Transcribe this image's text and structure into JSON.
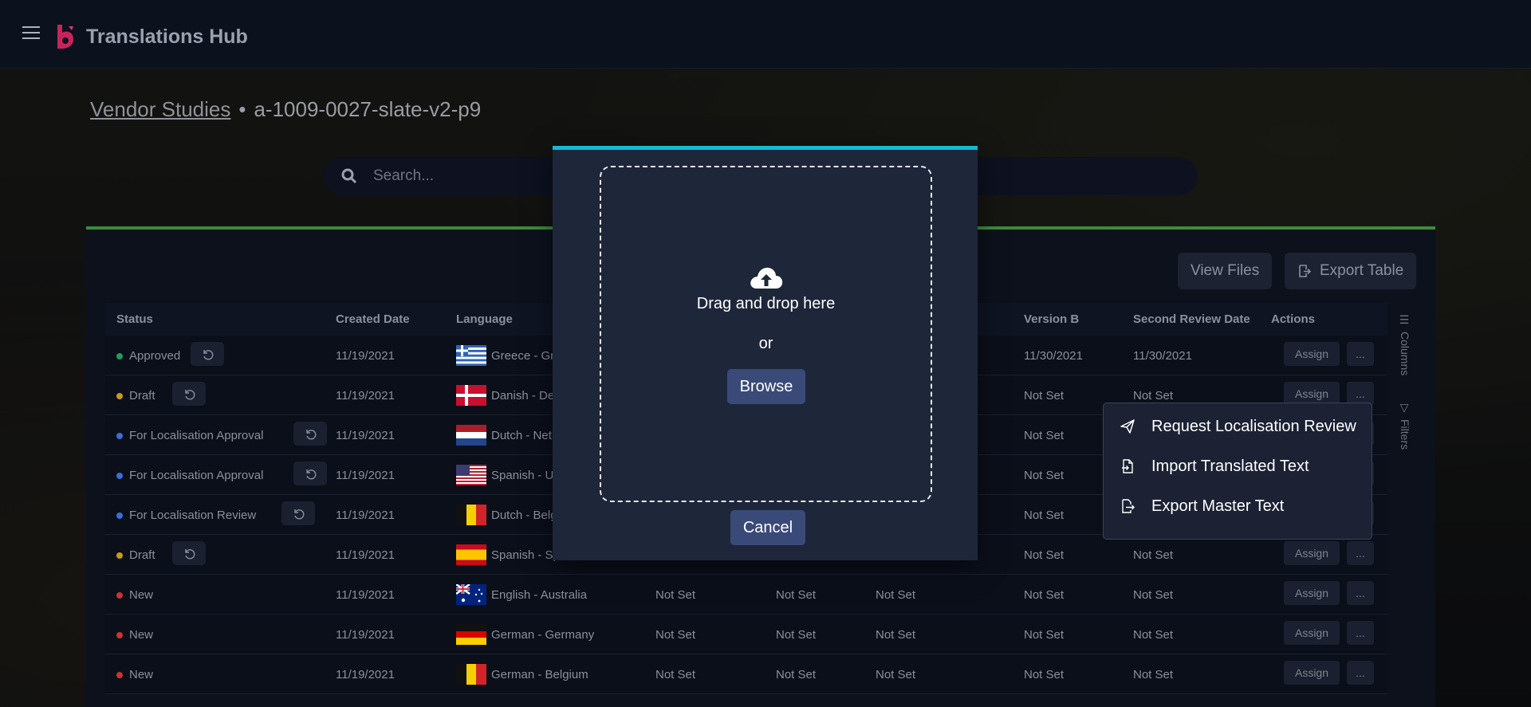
{
  "app": {
    "title": "Translations Hub",
    "logo_name": "translations-hub-logo-icon"
  },
  "breadcrumb": {
    "parent": "Vendor Studies",
    "separator": "•",
    "current": "a-1009-0027-slate-v2-p9"
  },
  "search": {
    "placeholder": "Search..."
  },
  "toolbar": {
    "view_files": "View Files",
    "export_table": "Export Table"
  },
  "columns": [
    "Status",
    "Created Date",
    "Language",
    "Version B",
    "Second Review Date",
    "Actions"
  ],
  "sidetabs": {
    "columns": "Columns",
    "filters": "Filters"
  },
  "status_colors": {
    "Approved": "#1e9e5a",
    "Draft": "#c99a1a",
    "For Localisation Approval": "#3b6fd6",
    "For Localisation Review": "#3b6fd6",
    "New": "#c73535"
  },
  "rows": [
    {
      "status": "Approved",
      "created": "11/19/2021",
      "language": "Greece - Gre",
      "flag": "greece",
      "c4": "",
      "c5": "",
      "c6": "",
      "version_b": "11/30/2021",
      "second_review": "11/30/2021",
      "undo": true
    },
    {
      "status": "Draft",
      "created": "11/19/2021",
      "language": "Danish - Den",
      "flag": "denmark",
      "c4": "",
      "c5": "",
      "c6": "",
      "version_b": "Not Set",
      "second_review": "Not Set",
      "undo": true
    },
    {
      "status": "For Localisation Approval",
      "created": "11/19/2021",
      "language": "Dutch - Neth",
      "flag": "netherlands",
      "c4": "",
      "c5": "",
      "c6": "",
      "version_b": "Not Set",
      "second_review": "",
      "undo": true
    },
    {
      "status": "For Localisation Approval",
      "created": "11/19/2021",
      "language": "Spanish - US",
      "flag": "usa",
      "c4": "",
      "c5": "",
      "c6": "",
      "version_b": "Not Set",
      "second_review": "",
      "undo": true
    },
    {
      "status": "For Localisation Review",
      "created": "11/19/2021",
      "language": "Dutch - Belg",
      "flag": "belgium",
      "c4": "",
      "c5": "",
      "c6": "",
      "version_b": "Not Set",
      "second_review": "",
      "undo": true
    },
    {
      "status": "Draft",
      "created": "11/19/2021",
      "language": "Spanish - Sp",
      "flag": "spain",
      "c4": "",
      "c5": "",
      "c6": "",
      "version_b": "Not Set",
      "second_review": "Not Set",
      "undo": true
    },
    {
      "status": "New",
      "created": "11/19/2021",
      "language": "English - Australia",
      "flag": "australia",
      "c4": "Not Set",
      "c5": "Not Set",
      "c6": "Not Set",
      "version_b": "Not Set",
      "second_review": "Not Set",
      "undo": false
    },
    {
      "status": "New",
      "created": "11/19/2021",
      "language": "German - Germany",
      "flag": "germany",
      "c4": "Not Set",
      "c5": "Not Set",
      "c6": "Not Set",
      "version_b": "Not Set",
      "second_review": "Not Set",
      "undo": false
    },
    {
      "status": "New",
      "created": "11/19/2021",
      "language": "German - Belgium",
      "flag": "belgium",
      "c4": "Not Set",
      "c5": "Not Set",
      "c6": "Not Set",
      "version_b": "Not Set",
      "second_review": "Not Set",
      "undo": false
    }
  ],
  "row_actions": {
    "assign": "Assign",
    "more": "..."
  },
  "upload_modal": {
    "drag_text": "Drag and drop here",
    "or_text": "or",
    "browse": "Browse",
    "cancel": "Cancel"
  },
  "context_menu": [
    {
      "label": "Request Localisation Review",
      "icon": "send-icon"
    },
    {
      "label": "Import Translated Text",
      "icon": "file-import-icon"
    },
    {
      "label": "Export Master Text",
      "icon": "file-export-icon"
    }
  ]
}
